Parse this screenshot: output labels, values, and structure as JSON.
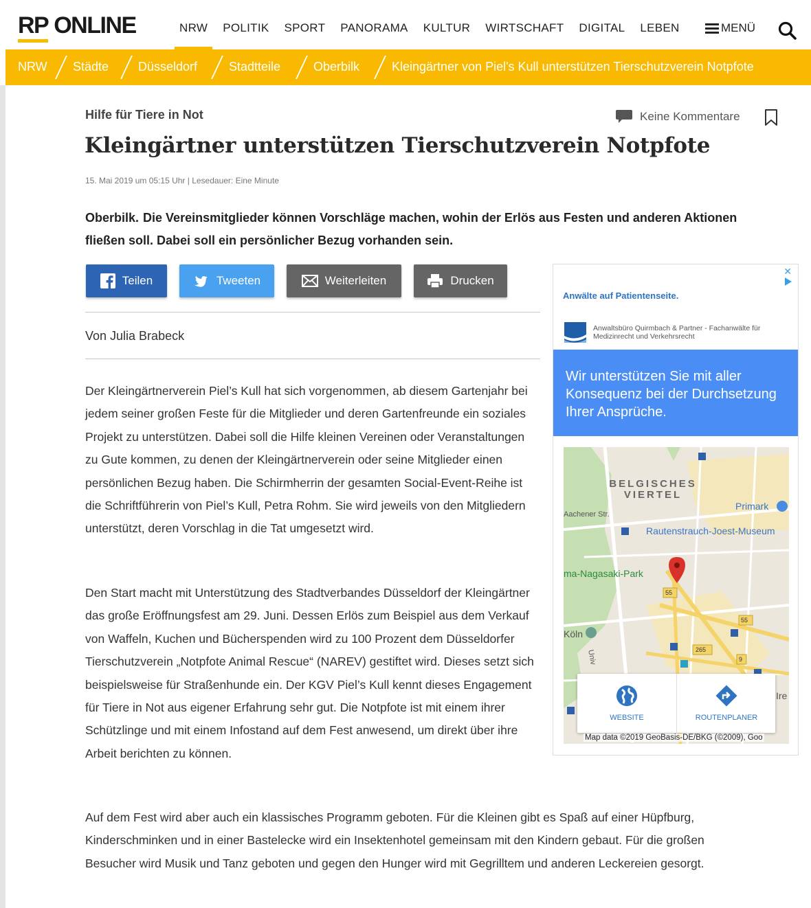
{
  "header": {
    "logo_rp": "RP",
    "logo_online": "ONLINE",
    "nav": [
      "NRW",
      "POLITIK",
      "SPORT",
      "PANORAMA",
      "KULTUR",
      "WIRTSCHAFT",
      "DIGITAL",
      "LEBEN"
    ],
    "menu_label": "MENÜ",
    "accent_color": "#f8b900"
  },
  "breadcrumb": [
    "NRW",
    "Städte",
    "Düsseldorf",
    "Stadtteile",
    "Oberbilk",
    "Kleingärtner von Piel's Kull unterstützen Tierschutzverein Notpfote"
  ],
  "article": {
    "kicker": "Hilfe für Tiere in Not",
    "comments_label": "Keine Kommentare",
    "headline": "Kleingärtner unterstützen Tierschutzverein Notpfote",
    "meta": "15. Mai 2019 um 05:15 Uhr | Lesedauer: Eine Minute",
    "teaser_location": "Oberbilk.",
    "teaser_text": "Die Vereinsmitglieder können Vorschläge machen, wohin der Erlös aus Festen und anderen Aktionen fließen soll. Dabei soll ein persönlicher Bezug vorhanden sein.",
    "author": "Von Julia Brabeck",
    "paragraphs": [
      "Der Kleingärtnerverein Piel’s Kull hat sich vorgenommen, ab diesem Gartenjahr bei jedem seiner großen Feste für die Mitglieder und deren Gartenfreunde ein soziales Projekt zu unterstützen. Dabei soll die Hilfe kleinen Vereinen oder Veranstaltungen zu Gute kommen, zu denen der Kleingärtnerverein oder seine Mitglieder einen persönlichen Bezug haben. Die Schirmherrin der gesamten Social-Event-Reihe ist die Schriftführerin von Piel’s Kull, Petra Rohm. Sie wird jeweils von den Mitgliedern unterstützt, deren Vorschlag in die Tat umgesetzt wird.",
      "Den Start macht mit Unterstützung des Stadtverbandes Düsseldorf der Kleingärtner das große Eröffnungsfest am 29. Juni. Dessen Erlös zum Beispiel aus dem Verkauf von Waffeln, Kuchen und Bücherspenden wird zu 100 Prozent dem Düsseldorfer Tierschutzverein „Notpfote Animal Rescue“ (NAREV) gestiftet wird. Dieses setzt sich beispielsweise für Straßenhunde ein. Der KGV Piel’s Kull kennt dieses Engagement für Tiere in Not aus eigener Erfahrung sehr gut. Die Notpfote ist mit einem ihrer Schützlinge und mit einem Infostand auf dem Fest anwesend, um direkt über ihre Arbeit berichten zu können.",
      "Auf dem Fest wird aber auch ein klassisches Programm geboten. Für die Kleinen gibt es Spaß auf einer Hüpfburg, Kinderschminken und in einer Bastelecke wird ein Insektenhotel gemeinsam mit den Kindern gebaut. Für die großen Besucher wird Musik und Tanz geboten und gegen den Hunger wird mit Gegrilltem und anderen Leckereien gesorgt."
    ]
  },
  "share": {
    "facebook": "Teilen",
    "twitter": "Tweeten",
    "mail": "Weiterleiten",
    "print": "Drucken",
    "colors": {
      "facebook": "#2d64b3",
      "twitter": "#4aa1f0",
      "gray": "#656565"
    }
  },
  "ad": {
    "title": "Anwälte auf Patientenseite.",
    "advertiser": "Anwaltsbüro Quirmbach & Partner - Fachanwälte für Medizinrecht und Verkehrsrecht",
    "headline": "Wir unterstützen Sie mit aller Konsequenz bei der Durchsetzung Ihrer Ansprüche.",
    "map_labels": {
      "district_1": "BELGISCHES",
      "district_2": "VIERTEL",
      "primark": "Primark",
      "museum": "Rautenstrauch-Joest-Museum",
      "park": "ma-Nagasaki-Park",
      "street": "Aachener Str.",
      "koeln": "Köln",
      "univ": "Univ",
      "ire": "Ire",
      "road_55a": "55",
      "road_55b": "55",
      "road_265": "265",
      "road_9": "9"
    },
    "website_label": "WEBSITE",
    "route_label": "ROUTENPLANER",
    "attribution": "Map data ©2019 GeoBasis-DE/BKG (©2009), Goo"
  }
}
